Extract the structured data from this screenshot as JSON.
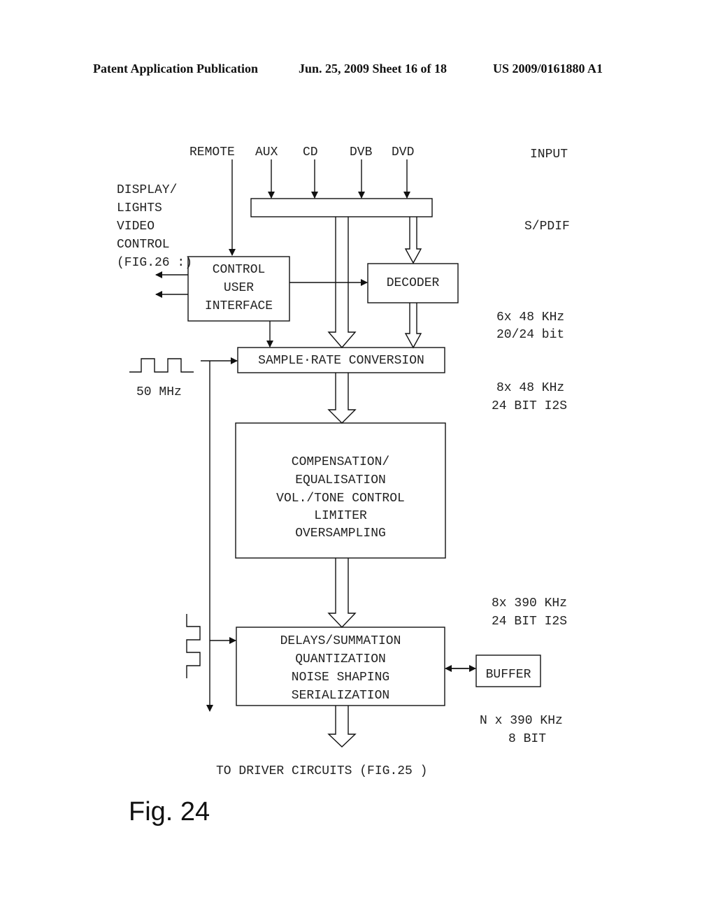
{
  "header": {
    "publication": "Patent Application Publication",
    "date_sheet": "Jun. 25, 2009  Sheet 16 of 18",
    "patent_number": "US 2009/0161880 A1"
  },
  "inputs": {
    "remote": "REMOTE",
    "aux": "AUX",
    "cd": "CD",
    "dvb": "DVB",
    "dvd": "DVD"
  },
  "left_labels": {
    "display": [
      "DISPLAY/",
      "LIGHTS",
      "VIDEO",
      "CONTROL",
      "(FIG.26 :)"
    ],
    "clock_freq": "50 MHz"
  },
  "blocks": {
    "control_ui": [
      "CONTROL",
      "USER",
      "INTERFACE"
    ],
    "decoder": "DECODER",
    "src": "SAMPLE·RATE CONVERSION",
    "compensation": [
      "COMPENSATION/",
      "EQUALISATION",
      "VOL./TONE CONTROL",
      "LIMITER",
      "OVERSAMPLING"
    ],
    "delays": [
      "DELAYS/SUMMATION",
      "QUANTIZATION",
      "NOISE SHAPING",
      "SERIALIZATION"
    ],
    "buffer": "BUFFER"
  },
  "right_labels": {
    "input": "INPUT",
    "spdif": "S/PDIF",
    "rate1": [
      "6x 48 KHz",
      "20/24 bit"
    ],
    "rate2": [
      "8x 48 KHz",
      "24 BIT I2S"
    ],
    "rate3": [
      "8x 390 KHz",
      "24 BIT I2S"
    ],
    "rate4": [
      "N x 390 KHz",
      "8 BIT"
    ]
  },
  "output_label": "TO DRIVER CIRCUITS (FIG.25 )",
  "figure_label": "Fig. 24"
}
